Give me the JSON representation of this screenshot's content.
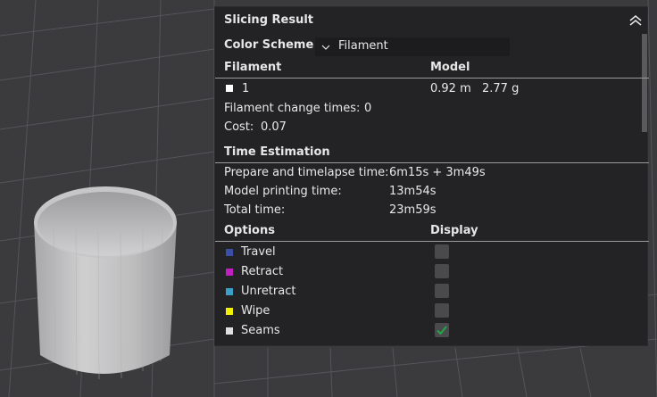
{
  "panel": {
    "title": "Slicing Result",
    "color_scheme_label": "Color Scheme",
    "color_scheme_value": "Filament"
  },
  "filament": {
    "col_filament": "Filament",
    "col_model": "Model",
    "item_index": "1",
    "item_color": "#ffffff",
    "model_length": "0.92 m",
    "model_weight": "2.77 g",
    "change_times_label": "Filament change times:",
    "change_times_value": "0",
    "cost_label": "Cost:",
    "cost_value": "0.07"
  },
  "time": {
    "header": "Time Estimation",
    "rows": [
      {
        "label": "Prepare and timelapse time:",
        "value": "6m15s + 3m49s"
      },
      {
        "label": "Model printing time:",
        "value": "13m54s"
      },
      {
        "label": "Total time:",
        "value": "23m59s"
      }
    ]
  },
  "options": {
    "col_options": "Options",
    "col_display": "Display",
    "items": [
      {
        "label": "Travel",
        "color": "#3a4fa8",
        "checked": false
      },
      {
        "label": "Retract",
        "color": "#c020c0",
        "checked": false
      },
      {
        "label": "Unretract",
        "color": "#3aa0c8",
        "checked": false
      },
      {
        "label": "Wipe",
        "color": "#f0f000",
        "checked": false
      },
      {
        "label": "Seams",
        "color": "#e0e0e0",
        "checked": true
      }
    ]
  },
  "colors": {
    "panel_bg": "#232325",
    "accent_check": "#22a84a"
  }
}
